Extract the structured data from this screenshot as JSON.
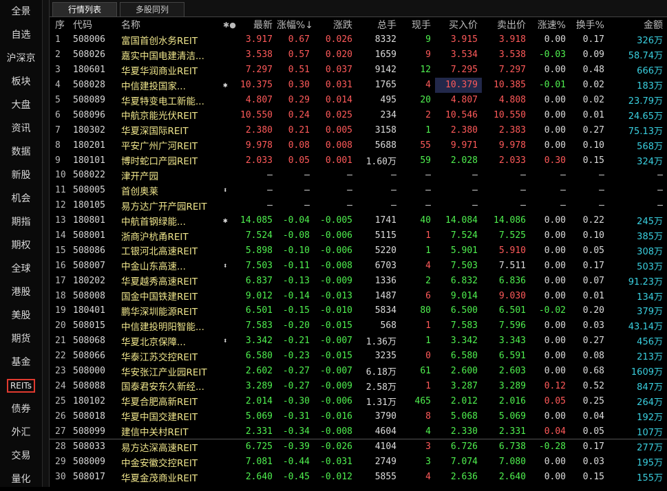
{
  "sidebar": [
    "全景",
    "自选",
    "沪深京",
    "板块",
    "大盘",
    "资讯",
    "数据",
    "新股",
    "机会",
    "期指",
    "期权",
    "全球",
    "港股",
    "美股",
    "期货",
    "基金",
    "REITs",
    "债券",
    "外汇",
    "交易",
    "量化"
  ],
  "active_sidebar": "REITs",
  "tabs": [
    "行情列表",
    "多股同列"
  ],
  "columns": [
    "序",
    "代码",
    "名称",
    "",
    "最新",
    "涨幅%↓",
    "涨跌",
    "总手",
    "现手",
    "买入价",
    "卖出价",
    "涨速%",
    "换手%",
    "金额"
  ],
  "name_header_icons": "✱●",
  "rows": [
    [
      "1",
      "508006",
      "富国首创水务REIT",
      "",
      "3.917",
      "0.67",
      "0.026",
      "8332",
      "9",
      "3.915",
      "3.918",
      "0.00",
      "0.17",
      "326万"
    ],
    [
      "2",
      "508026",
      "嘉实中国电建清洁...",
      "",
      "3.538",
      "0.57",
      "0.020",
      "1659",
      "9",
      "3.534",
      "3.538",
      "-0.03",
      "0.09",
      "58.74万"
    ],
    [
      "3",
      "180601",
      "华夏华润商业REIT",
      "",
      "7.297",
      "0.51",
      "0.037",
      "9142",
      "12",
      "7.295",
      "7.297",
      "0.00",
      "0.48",
      "666万"
    ],
    [
      "4",
      "508028",
      "中信建投国家...",
      "✱",
      "10.375",
      "0.30",
      "0.031",
      "1765",
      "4",
      "10.379",
      "10.385",
      "-0.01",
      "0.02",
      "183万"
    ],
    [
      "5",
      "508089",
      "华夏特变电工新能...",
      "",
      "4.807",
      "0.29",
      "0.014",
      "495",
      "20",
      "4.807",
      "4.808",
      "0.00",
      "0.02",
      "23.79万"
    ],
    [
      "6",
      "508096",
      "中航京能光伏REIT",
      "",
      "10.550",
      "0.24",
      "0.025",
      "234",
      "2",
      "10.546",
      "10.550",
      "0.00",
      "0.01",
      "24.65万"
    ],
    [
      "7",
      "180302",
      "华夏深国际REIT",
      "",
      "2.380",
      "0.21",
      "0.005",
      "3158",
      "1",
      "2.380",
      "2.383",
      "0.00",
      "0.27",
      "75.13万"
    ],
    [
      "8",
      "180201",
      "平安广州广河REIT",
      "",
      "9.978",
      "0.08",
      "0.008",
      "5688",
      "55",
      "9.971",
      "9.978",
      "0.00",
      "0.10",
      "568万"
    ],
    [
      "9",
      "180101",
      "博时蛇口产园REIT",
      "",
      "2.033",
      "0.05",
      "0.001",
      "1.60万",
      "59",
      "2.028",
      "2.033",
      "0.30",
      "0.15",
      "324万"
    ],
    [
      "10",
      "508022",
      "津开产园",
      "",
      "—",
      "—",
      "—",
      "—",
      "—",
      "—",
      "—",
      "—",
      "—",
      "—"
    ],
    [
      "11",
      "508005",
      "首创奥莱",
      "⬍",
      "—",
      "—",
      "—",
      "—",
      "—",
      "—",
      "—",
      "—",
      "—",
      "—"
    ],
    [
      "12",
      "180105",
      "易方达广开产园REIT",
      "",
      "—",
      "—",
      "—",
      "—",
      "—",
      "—",
      "—",
      "—",
      "—",
      "—"
    ],
    [
      "13",
      "180801",
      "中航首钢绿能...",
      "✱",
      "14.085",
      "-0.04",
      "-0.005",
      "1741",
      "40",
      "14.084",
      "14.086",
      "0.00",
      "0.22",
      "245万"
    ],
    [
      "14",
      "508001",
      "浙商沪杭甬REIT",
      "",
      "7.524",
      "-0.08",
      "-0.006",
      "5115",
      "1",
      "7.524",
      "7.525",
      "0.00",
      "0.10",
      "385万"
    ],
    [
      "15",
      "508086",
      "工银河北高速REIT",
      "",
      "5.898",
      "-0.10",
      "-0.006",
      "5220",
      "1",
      "5.901",
      "5.910",
      "0.00",
      "0.05",
      "308万"
    ],
    [
      "16",
      "508007",
      "中金山东高速...",
      "⬍",
      "7.503",
      "-0.11",
      "-0.008",
      "6703",
      "4",
      "7.503",
      "7.511",
      "0.00",
      "0.17",
      "503万"
    ],
    [
      "17",
      "180202",
      "华夏越秀高速REIT",
      "",
      "6.837",
      "-0.13",
      "-0.009",
      "1336",
      "2",
      "6.832",
      "6.836",
      "0.00",
      "0.07",
      "91.23万"
    ],
    [
      "18",
      "508008",
      "国金中国铁建REIT",
      "",
      "9.012",
      "-0.14",
      "-0.013",
      "1487",
      "6",
      "9.014",
      "9.030",
      "0.00",
      "0.01",
      "134万"
    ],
    [
      "19",
      "180401",
      "鹏华深圳能源REIT",
      "",
      "6.501",
      "-0.15",
      "-0.010",
      "5834",
      "80",
      "6.500",
      "6.501",
      "-0.02",
      "0.20",
      "379万"
    ],
    [
      "20",
      "508015",
      "中信建投明阳智能...",
      "",
      "7.583",
      "-0.20",
      "-0.015",
      "568",
      "1",
      "7.583",
      "7.596",
      "0.00",
      "0.03",
      "43.14万"
    ],
    [
      "21",
      "508068",
      "华夏北京保障...",
      "⬍",
      "3.342",
      "-0.21",
      "-0.007",
      "1.36万",
      "1",
      "3.342",
      "3.343",
      "0.00",
      "0.27",
      "456万"
    ],
    [
      "22",
      "508066",
      "华泰江苏交控REIT",
      "",
      "6.580",
      "-0.23",
      "-0.015",
      "3235",
      "0",
      "6.580",
      "6.591",
      "0.00",
      "0.08",
      "213万"
    ],
    [
      "23",
      "508000",
      "华安张江产业园REIT",
      "",
      "2.602",
      "-0.27",
      "-0.007",
      "6.18万",
      "61",
      "2.600",
      "2.603",
      "0.00",
      "0.68",
      "1609万"
    ],
    [
      "24",
      "508088",
      "国泰君安东久新经...",
      "",
      "3.289",
      "-0.27",
      "-0.009",
      "2.58万",
      "1",
      "3.287",
      "3.289",
      "0.12",
      "0.52",
      "847万"
    ],
    [
      "25",
      "180102",
      "华夏合肥高新REIT",
      "",
      "2.014",
      "-0.30",
      "-0.006",
      "1.31万",
      "465",
      "2.012",
      "2.016",
      "0.05",
      "0.25",
      "264万"
    ],
    [
      "26",
      "508018",
      "华夏中国交建REIT",
      "",
      "5.069",
      "-0.31",
      "-0.016",
      "3790",
      "8",
      "5.068",
      "5.069",
      "0.00",
      "0.04",
      "192万"
    ],
    [
      "27",
      "508099",
      "建信中关村REIT",
      "",
      "2.331",
      "-0.34",
      "-0.008",
      "4604",
      "4",
      "2.330",
      "2.331",
      "0.04",
      "0.05",
      "107万"
    ],
    [
      "28",
      "508033",
      "易方达深高速REIT",
      "",
      "6.725",
      "-0.39",
      "-0.026",
      "4104",
      "3",
      "6.726",
      "6.738",
      "-0.28",
      "0.17",
      "277万"
    ],
    [
      "29",
      "508009",
      "中金安徽交控REIT",
      "",
      "7.081",
      "-0.44",
      "-0.031",
      "2749",
      "3",
      "7.074",
      "7.080",
      "0.00",
      "0.03",
      "195万"
    ],
    [
      "30",
      "508017",
      "华夏金茂商业REIT",
      "",
      "2.640",
      "-0.45",
      "-0.012",
      "5855",
      "4",
      "2.636",
      "2.640",
      "0.00",
      "0.15",
      "155万"
    ]
  ],
  "colors": {
    "up": "#ff5a5a",
    "down": "#4ff04f",
    "flat": "#dddddd",
    "amount": "#3ad0e0",
    "name": "#f0e68c",
    "highlight": "#e03a2f"
  }
}
